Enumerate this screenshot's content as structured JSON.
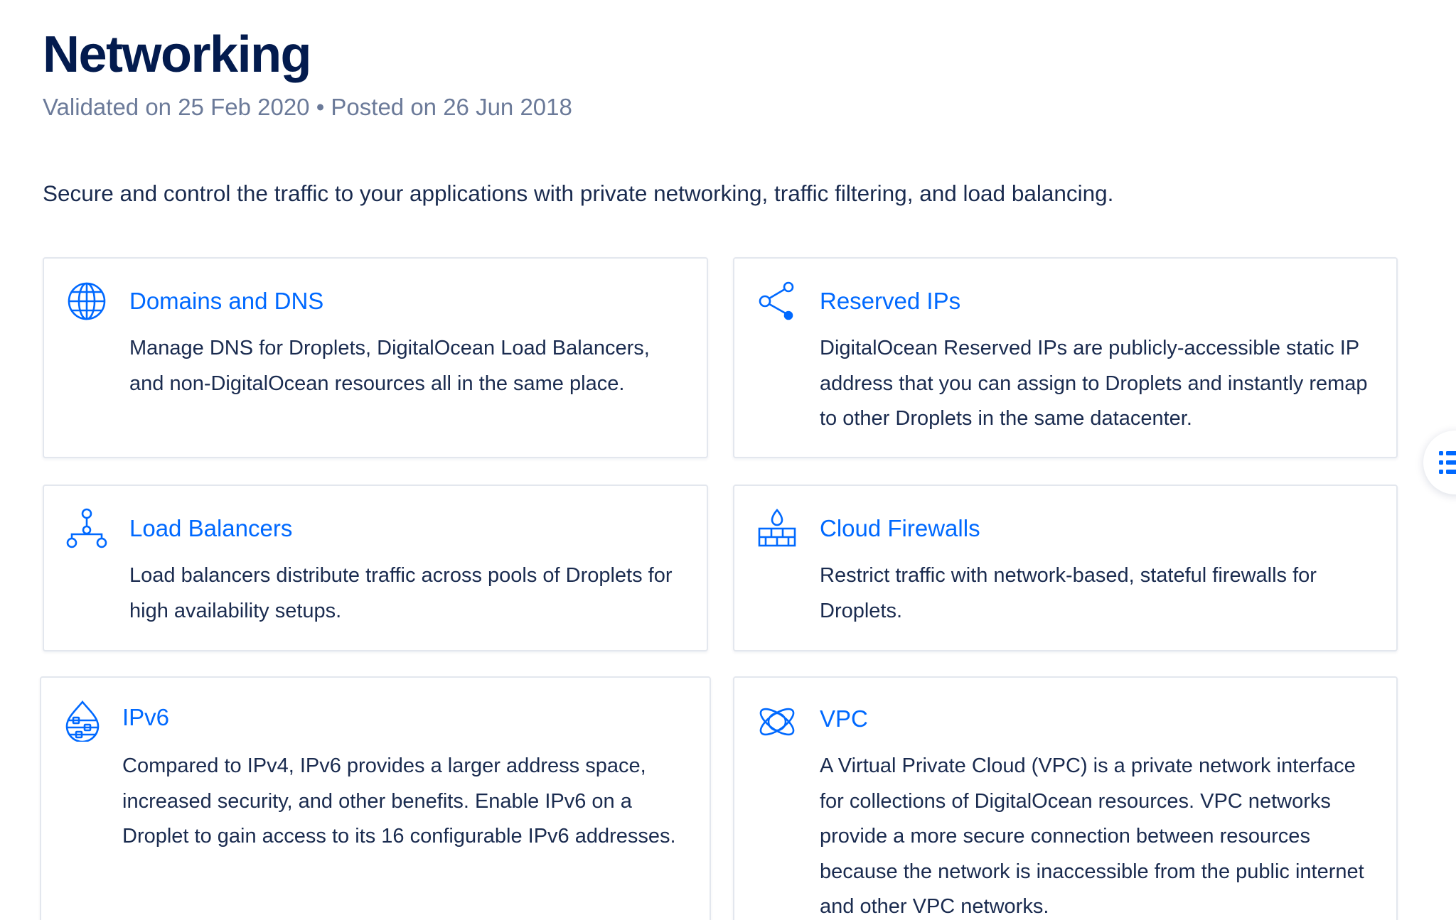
{
  "page": {
    "title": "Networking",
    "meta": "Validated on 25 Feb 2020 • Posted on 26 Jun 2018",
    "intro": "Secure and control the traffic to your applications with private networking, traffic filtering, and load balancing."
  },
  "colors": {
    "accent": "#0069ff",
    "heading": "#031b4e",
    "meta_text": "#6b7a99",
    "body_text": "#1a2b4f",
    "card_border": "#e3e7ee"
  },
  "cards": [
    {
      "title": "Domains and DNS",
      "icon": "globe-icon",
      "description": "Manage DNS for Droplets, DigitalOcean Load Balancers, and non-DigitalOcean resources all in the same place."
    },
    {
      "title": "Reserved IPs",
      "icon": "share-nodes-icon",
      "description": "DigitalOcean Reserved IPs are publicly-accessible static IP address that you can assign to Droplets and instantly remap to other Droplets in the same datacenter."
    },
    {
      "title": "Load Balancers",
      "icon": "load-balancer-icon",
      "description": "Load balancers distribute traffic across pools of Droplets for high availability setups."
    },
    {
      "title": "Cloud Firewalls",
      "icon": "firewall-icon",
      "description": "Restrict traffic with network-based, stateful firewalls for Droplets."
    },
    {
      "title": "IPv6",
      "icon": "ipv6-drop-icon",
      "description": "Compared to IPv4, IPv6 provides a larger address space, increased security, and other benefits. Enable IPv6 on a Droplet to gain access to its 16 configurable IPv6 addresses."
    },
    {
      "title": "VPC",
      "icon": "vpc-network-icon",
      "description": "A Virtual Private Cloud (VPC) is a private network interface for collections of DigitalOcean resources. VPC networks provide a more secure connection between resources because the network is inaccessible from the public internet and other VPC networks."
    }
  ],
  "toc": {
    "icon": "list-icon"
  }
}
